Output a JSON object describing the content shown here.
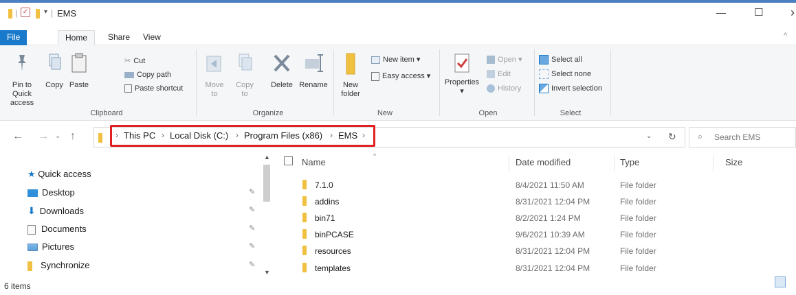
{
  "window": {
    "title": "EMS",
    "minimize_glyph": "—",
    "maximize_glyph": "☐",
    "close_glyph": "›"
  },
  "tabs": {
    "file": "File",
    "home": "Home",
    "share": "Share",
    "view": "View"
  },
  "ribbon": {
    "clipboard": {
      "pin": "Pin to Quick access",
      "copy": "Copy",
      "paste": "Paste",
      "cut": "Cut",
      "copy_path": "Copy path",
      "paste_shortcut": "Paste shortcut",
      "group_label": "Clipboard"
    },
    "organize": {
      "move_to": "Move to",
      "copy_to": "Copy to",
      "delete": "Delete",
      "rename": "Rename",
      "group_label": "Organize"
    },
    "new": {
      "new_folder": "New folder",
      "new_item": "New item",
      "easy_access": "Easy access",
      "group_label": "New"
    },
    "open": {
      "properties": "Properties",
      "open": "Open",
      "edit": "Edit",
      "history": "History",
      "group_label": "Open"
    },
    "select": {
      "select_all": "Select all",
      "select_none": "Select none",
      "invert_selection": "Invert selection",
      "group_label": "Select"
    }
  },
  "breadcrumb": [
    "This PC",
    "Local Disk (C:)",
    "Program Files (x86)",
    "EMS"
  ],
  "search": {
    "placeholder": "Search EMS"
  },
  "nav_pane": {
    "quick_access": "Quick access",
    "items": [
      "Desktop",
      "Downloads",
      "Documents",
      "Pictures",
      "Synchronize"
    ]
  },
  "columns": {
    "name": "Name",
    "date": "Date modified",
    "type": "Type",
    "size": "Size"
  },
  "files": [
    {
      "name": "7.1.0",
      "date": "8/4/2021 11:50 AM",
      "type": "File folder"
    },
    {
      "name": "addins",
      "date": "8/31/2021 12:04 PM",
      "type": "File folder"
    },
    {
      "name": "bin71",
      "date": "8/2/2021 1:24 PM",
      "type": "File folder"
    },
    {
      "name": "binPCASE",
      "date": "9/6/2021 10:39 AM",
      "type": "File folder"
    },
    {
      "name": "resources",
      "date": "8/31/2021 12:04 PM",
      "type": "File folder"
    },
    {
      "name": "templates",
      "date": "8/31/2021 12:04 PM",
      "type": "File folder"
    }
  ],
  "status": {
    "item_count": "6 items"
  },
  "colors": {
    "accent": "#1979ca",
    "highlight_box": "#e02020",
    "folder": "#f0c040"
  }
}
